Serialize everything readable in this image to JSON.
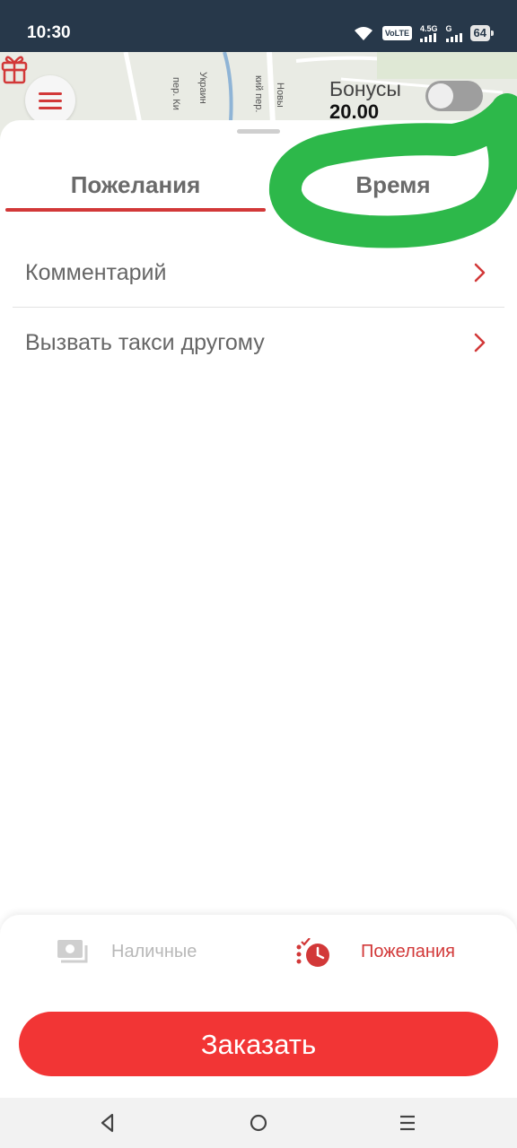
{
  "status_bar": {
    "time": "10:30",
    "volte": "VoLTE",
    "net1": "4.5G",
    "net2": "G",
    "battery": "64"
  },
  "map": {
    "streets": [
      "пер. Ки",
      "Украин",
      "кий пер.",
      "Новы"
    ]
  },
  "bonus": {
    "label": "Бонусы",
    "value": "20.00"
  },
  "tabs": [
    {
      "label": "Пожелания",
      "active": true
    },
    {
      "label": "Время",
      "active": false
    }
  ],
  "options": [
    {
      "label": "Комментарий"
    },
    {
      "label": "Вызвать такси другому"
    }
  ],
  "bottom": {
    "payment_label": "Наличные",
    "wishes_label": "Пожелания",
    "order_button": "Заказать"
  },
  "colors": {
    "accent": "#d23838",
    "order_button": "#f23535",
    "status_bar": "#27384a",
    "annotation": "#2db84a"
  },
  "icons": [
    "menu-icon",
    "gift-icon",
    "chevron-right-icon",
    "cash-icon",
    "wishes-clock-icon",
    "back-icon",
    "home-icon",
    "recents-icon"
  ]
}
